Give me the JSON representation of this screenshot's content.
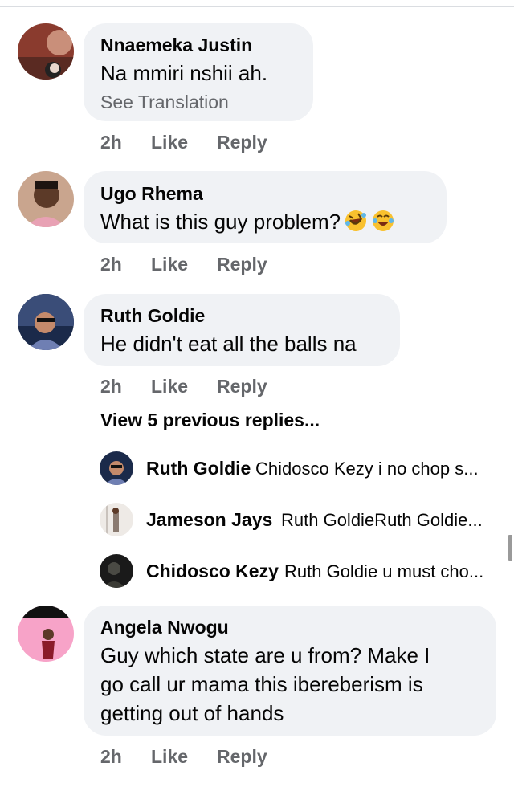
{
  "comments": [
    {
      "author": "Nnaemeka Justin",
      "text": "Na mmiri nshii ah.",
      "translate_label": "See Translation",
      "time": "2h",
      "like_label": "Like",
      "reply_label": "Reply"
    },
    {
      "author": "Ugo Rhema",
      "text": "What is this guy problem?",
      "emojis": [
        "rolling-on-floor-laughing-icon",
        "tears-of-joy-icon"
      ],
      "time": "2h",
      "like_label": "Like",
      "reply_label": "Reply"
    },
    {
      "author": "Ruth Goldie",
      "text": "He didn't eat all the balls na",
      "time": "2h",
      "like_label": "Like",
      "reply_label": "Reply"
    },
    {
      "author": "Angela Nwogu",
      "text_lines": [
        "Guy which state are u from? Make I",
        "go call ur mama this ibereberism is",
        "getting out of hands"
      ],
      "time": "2h",
      "like_label": "Like",
      "reply_label": "Reply"
    }
  ],
  "view_previous": "View 5 previous replies...",
  "replies": [
    {
      "author": "Ruth Goldie",
      "text": "Chidosco Kezy i no chop s..."
    },
    {
      "author": "Jameson Jays",
      "text": "Ruth GoldieRuth Goldie..."
    },
    {
      "author": "Chidosco Kezy",
      "text": "Ruth Goldie u must cho..."
    }
  ],
  "colors": {
    "bubble": "#f0f2f5",
    "meta_text": "#65676b",
    "primary_text": "#050505"
  }
}
